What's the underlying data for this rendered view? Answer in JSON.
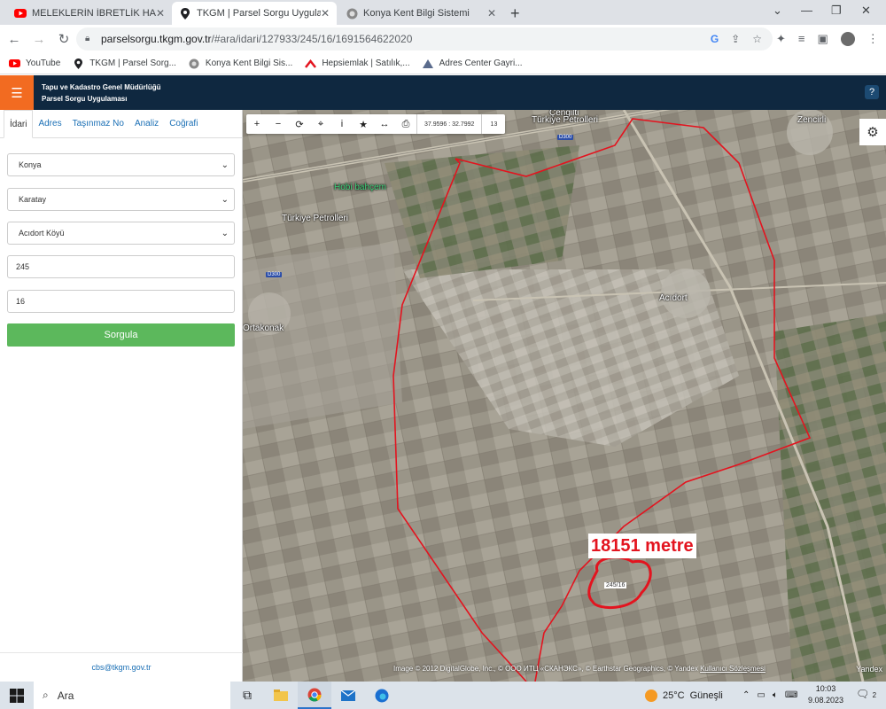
{
  "browser": {
    "tabs": [
      {
        "title": "MELEKLERİN İBRETLİK HALLERİ -",
        "icon": "youtube-icon"
      },
      {
        "title": "TKGM | Parsel Sorgu Uygulaması",
        "icon": "map-pin-icon"
      },
      {
        "title": "Konya Kent Bilgi Sistemi",
        "icon": "globe-icon"
      }
    ],
    "url_host": "parselsorgu.tkgm.gov.tr",
    "url_path": "/#ara/idari/127933/245/16/1691564622020",
    "bookmarks": [
      {
        "label": "YouTube",
        "icon": "youtube-icon"
      },
      {
        "label": "TKGM | Parsel Sorg...",
        "icon": "map-pin-icon"
      },
      {
        "label": "Konya Kent Bilgi Sis...",
        "icon": "globe-icon"
      },
      {
        "label": "Hepsiemlak | Satılık,...",
        "icon": "hepsiemlak-icon"
      },
      {
        "label": "Adres Center Gayri...",
        "icon": "triangle-icon"
      }
    ]
  },
  "app": {
    "title_line1": "Tapu ve Kadastro Genel Müdürlüğü",
    "title_line2": "Parsel Sorgu Uygulaması",
    "help": "?"
  },
  "sidebar": {
    "tabs": [
      "İdari",
      "Adres",
      "Taşınmaz No",
      "Analiz",
      "Coğrafi"
    ],
    "active_tab": "İdari",
    "il": "Konya",
    "ilce": "Karatay",
    "mahalle": "Acıdort Köyü",
    "ada": "245",
    "parsel": "16",
    "submit_label": "Sorgula",
    "footer_email": "cbs@tkgm.gov.tr"
  },
  "map": {
    "coordinates": "37.9596 : 32.7992",
    "zoom": "13",
    "distance_label": "18151 metre",
    "parcel_label": "245/16",
    "places": {
      "cengilti": "Çengilti",
      "turkiye_petrolleri_1": "Türkiye Petrolleri",
      "hobi_bahcem": "Hobi bahçem",
      "turkiye_petrolleri_2": "Türkiye Petrolleri",
      "zencirli": "Zencirli",
      "acidort": "Acıdort",
      "ortakonak": "Ortakonak",
      "road_d300_a": "D300",
      "road_d300_b": "D300"
    },
    "attribution_text": "Image © 2012 DigitalGlobe, Inc., © ООО ИТЦ «СКАНЭКС», © Earthstar Geographics, © Yandex",
    "terms_link": "Kullanıcı Sözleşmesi",
    "brand": "Yandex"
  },
  "taskbar": {
    "search_placeholder": "Ara",
    "temperature": "25°C",
    "weather": "Güneşli",
    "time": "10:03",
    "date": "9.08.2023",
    "notification_count": "2"
  },
  "colors": {
    "header_bg": "#0f2840",
    "menu_orange": "#f26b21",
    "button_green": "#5cb85c",
    "boundary_red": "#e3141f",
    "link_blue": "#1a6fb5"
  }
}
